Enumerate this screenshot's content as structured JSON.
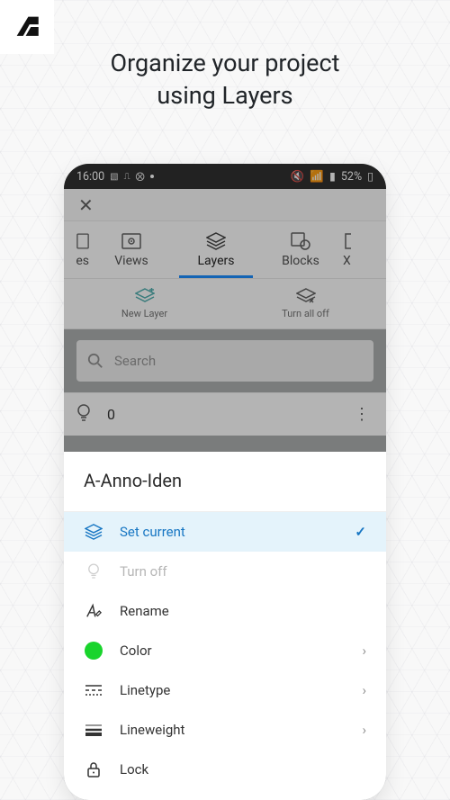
{
  "hero": {
    "line1": "Organize your project",
    "line2": "using Layers"
  },
  "statusbar": {
    "time": "16:00",
    "battery": "52%"
  },
  "tabs": {
    "items": [
      {
        "label": "es"
      },
      {
        "label": "Views"
      },
      {
        "label": "Layers"
      },
      {
        "label": "Blocks"
      },
      {
        "label": "X"
      }
    ]
  },
  "layer_actions": {
    "new": "New Layer",
    "turn_off": "Turn all off"
  },
  "search": {
    "placeholder": "Search"
  },
  "layer_row": {
    "name": "0"
  },
  "sheet": {
    "layer_name": "A-Anno-Iden",
    "items": {
      "set_current": "Set current",
      "turn_off": "Turn off",
      "rename": "Rename",
      "color": "Color",
      "linetype": "Linetype",
      "lineweight": "Lineweight",
      "lock": "Lock"
    },
    "color_value": "#19d42c"
  }
}
